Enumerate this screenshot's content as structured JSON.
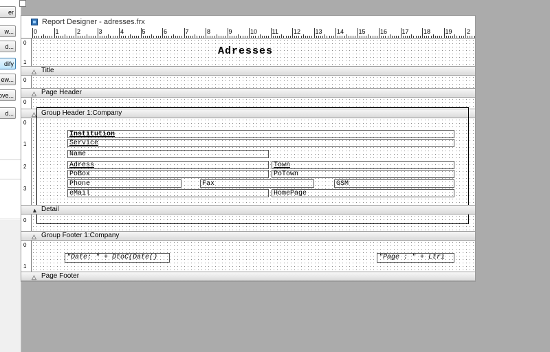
{
  "window": {
    "title": "Report Designer - adresses.frx"
  },
  "side_buttons": [
    "er",
    "w...",
    "d...",
    "dify",
    "ew...",
    "ove...",
    "d..."
  ],
  "ruler": {
    "marks": [
      "0",
      "1",
      "2",
      "3",
      "4",
      "5",
      "6",
      "7",
      "8",
      "9",
      "10",
      "11",
      "12",
      "13",
      "14",
      "15",
      "16",
      "17",
      "18",
      "19",
      "2"
    ]
  },
  "bands": {
    "title": {
      "label": "Title",
      "report_title": "Adresses"
    },
    "page_header": {
      "label": "Page Header"
    },
    "group_header": {
      "label": "Group Header 1:Company"
    },
    "detail": {
      "label": "Detail"
    },
    "group_footer": {
      "label": "Group Footer 1:Company"
    },
    "page_footer": {
      "label": "Page Footer"
    }
  },
  "fields": {
    "institution": "Institution",
    "service": "Service",
    "name": "Name",
    "adress": "Adress",
    "town": "Town",
    "pobox": "PoBox",
    "potown": "PoTown",
    "phone": "Phone",
    "fax": "Fax",
    "gsm": "GSM",
    "email": "eMail",
    "homepage": "HomePage",
    "date_expr": "\"Date: \" + DtoC(Date()",
    "page_expr": "\"Page : \" + Ltri"
  },
  "vruler_marks": {
    "title": [
      "0",
      "1"
    ],
    "page_header": [
      "0"
    ],
    "group_header": [
      "0",
      "1",
      "2",
      "3"
    ],
    "detail": [
      "0"
    ],
    "group_footer": [
      "0",
      "1"
    ]
  }
}
